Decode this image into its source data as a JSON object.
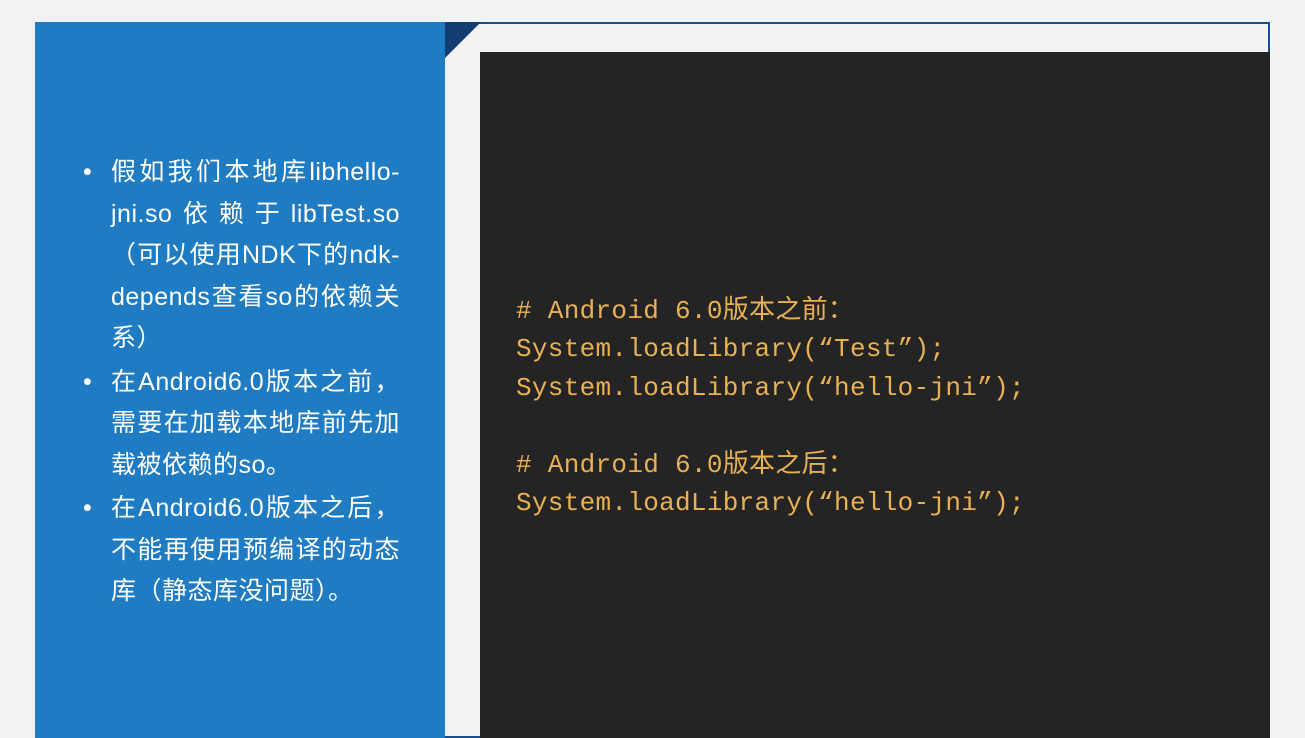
{
  "left": {
    "bullets": [
      "假如我们本地库libhello-jni.so依赖于libTest.so（可以使用NDK下的ndk-depends查看so的依赖关系）",
      "在Android6.0版本之前，需要在加载本地库前先加载被依赖的so。",
      "在Android6.0版本之后，不能再使用预编译的动态库（静态库没问题）。"
    ]
  },
  "code": {
    "text": "# Android 6.0版本之前：\nSystem.loadLibrary(“Test”);\nSystem.loadLibrary(“hello-jni”);\n\n# Android 6.0版本之后：\nSystem.loadLibrary(“hello-jni”);"
  }
}
